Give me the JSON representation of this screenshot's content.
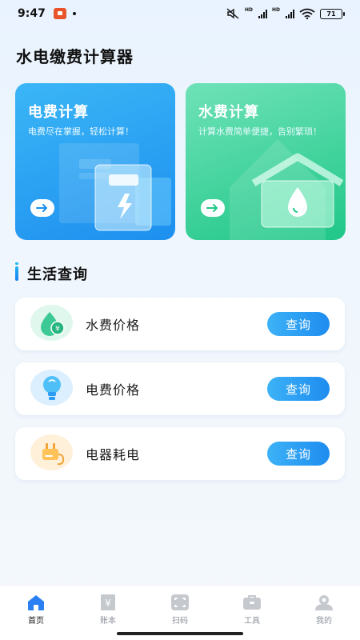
{
  "status_bar": {
    "time": "9:47",
    "hd1": "HD",
    "hd2": "HD",
    "battery": "71"
  },
  "app": {
    "title": "水电缴费计算器"
  },
  "cards": [
    {
      "title": "电费计算",
      "subtitle": "电费尽在掌握，轻松计算！",
      "color": "#1d8fef"
    },
    {
      "title": "水费计算",
      "subtitle": "计算水费简单便捷，告别繁琐！",
      "color": "#20c788"
    }
  ],
  "section": {
    "title": "生活查询"
  },
  "list": [
    {
      "label": "水费价格",
      "button": "查询",
      "icon": "water-price-icon"
    },
    {
      "label": "电费价格",
      "button": "查询",
      "icon": "bulb-icon"
    },
    {
      "label": "电器耗电",
      "button": "查询",
      "icon": "plug-icon"
    }
  ],
  "tabs": [
    {
      "label": "首页",
      "icon": "home-icon",
      "active": true
    },
    {
      "label": "账本",
      "icon": "ledger-icon",
      "active": false
    },
    {
      "label": "扫码",
      "icon": "scan-icon",
      "active": false
    },
    {
      "label": "工具",
      "icon": "toolbox-icon",
      "active": false
    },
    {
      "label": "我的",
      "icon": "profile-icon",
      "active": false
    }
  ],
  "colors": {
    "accent": "#1e8cf0",
    "green": "#20c788",
    "tab_active": "#2a7ff3"
  }
}
